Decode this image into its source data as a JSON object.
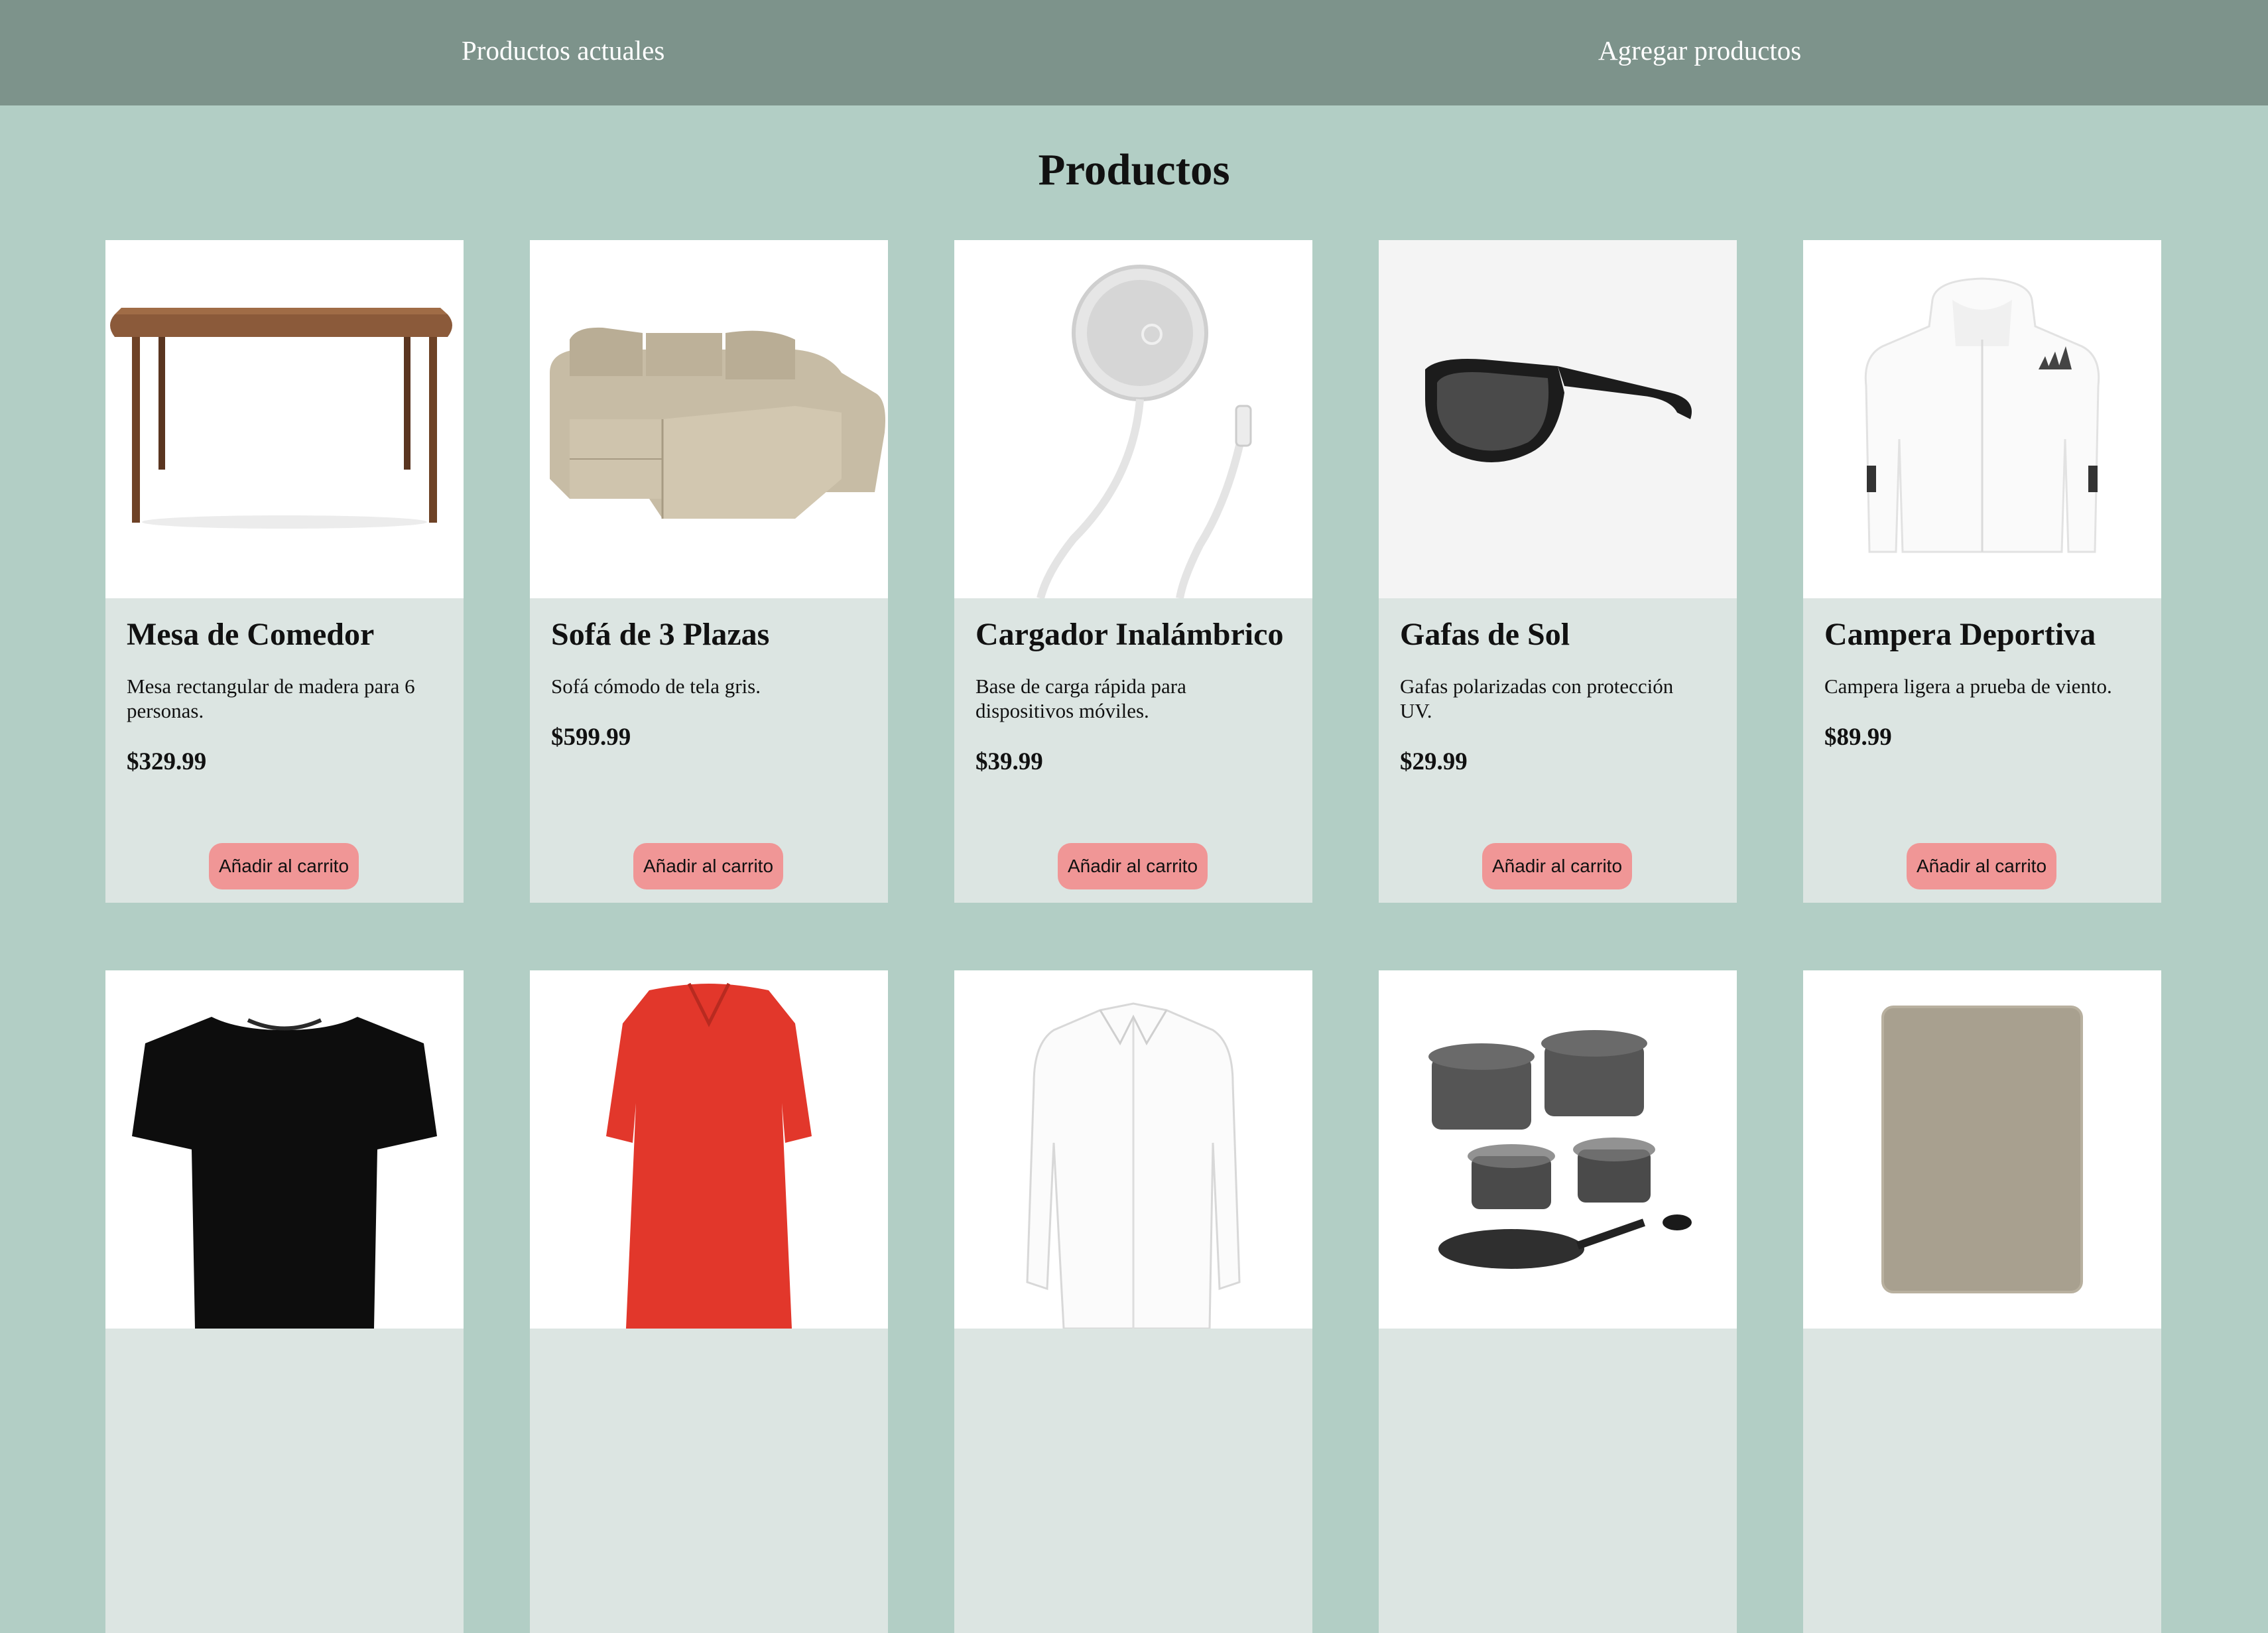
{
  "nav": {
    "current_products": "Productos actuales",
    "add_products": "Agregar productos"
  },
  "page": {
    "title": "Productos"
  },
  "products": [
    {
      "name": "Mesa de Comedor",
      "description": "Mesa rectangular de madera para 6 personas.",
      "price": "$329.99",
      "button": "Añadir al carrito",
      "image": "dining-table-image"
    },
    {
      "name": "Sofá de 3 Plazas",
      "description": "Sofá cómodo de tela gris.",
      "price": "$599.99",
      "button": "Añadir al carrito",
      "image": "sofa-image"
    },
    {
      "name": "Cargador Inalámbrico",
      "description": "Base de carga rápida para dispositivos móviles.",
      "price": "$39.99",
      "button": "Añadir al carrito",
      "image": "wireless-charger-image"
    },
    {
      "name": "Gafas de Sol",
      "description": "Gafas polarizadas con protección UV.",
      "price": "$29.99",
      "button": "Añadir al carrito",
      "image": "sunglasses-image"
    },
    {
      "name": "Campera Deportiva",
      "description": "Campera ligera a prueba de viento.",
      "price": "$89.99",
      "button": "Añadir al carrito",
      "image": "sports-jacket-image"
    },
    {
      "image": "black-tshirt-image"
    },
    {
      "image": "red-dress-image"
    },
    {
      "image": "white-shirt-image"
    },
    {
      "image": "cookware-set-image"
    },
    {
      "image": "rug-image"
    }
  ],
  "colors": {
    "background": "#b2cec5",
    "nav": "#7d938b",
    "card": "#dce5e2",
    "button": "#f09696"
  }
}
